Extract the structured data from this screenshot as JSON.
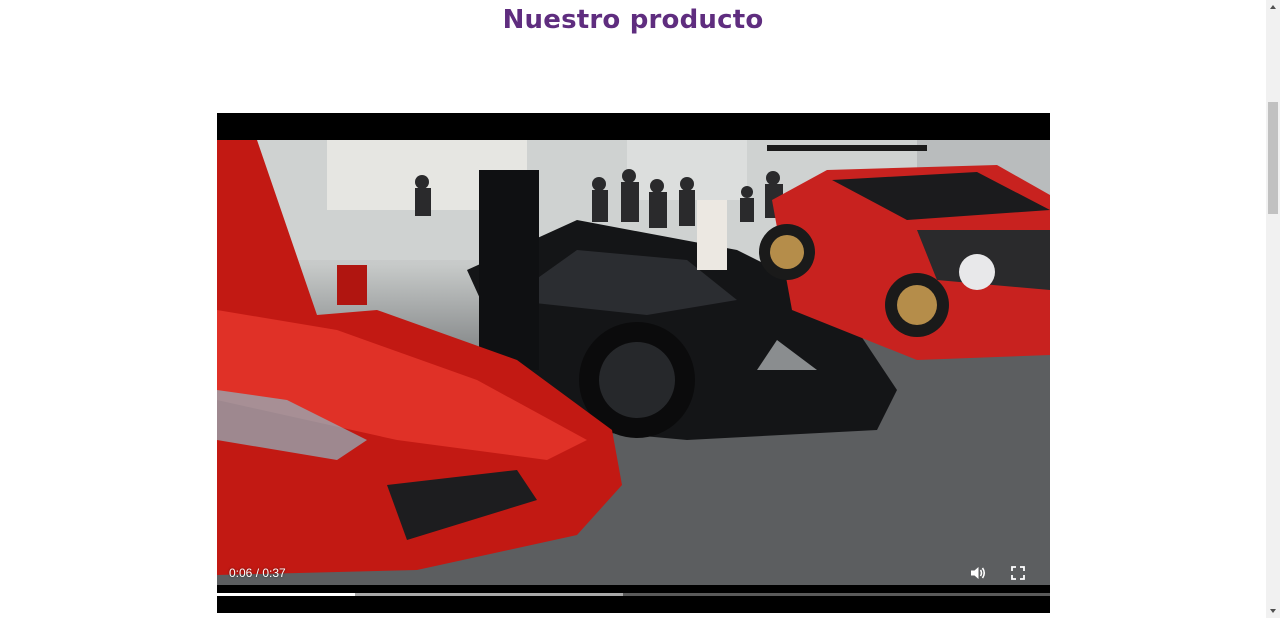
{
  "section": {
    "title": "Nuestro producto"
  },
  "video": {
    "current_time": "0:06",
    "duration": "0:37",
    "time_display": "0:06 / 0:37",
    "progress_played_fraction": 0.166,
    "progress_buffered_fraction": 0.487,
    "scene_description_icon": "video-frame",
    "volume_icon": "volume-icon",
    "fullscreen_icon": "fullscreen-icon"
  },
  "colors": {
    "title": "#5f2d7f",
    "player_bg": "#000000",
    "progress_played": "#ffffff",
    "progress_buffered": "#a8a8a8",
    "progress_track": "#5a5a5a"
  }
}
